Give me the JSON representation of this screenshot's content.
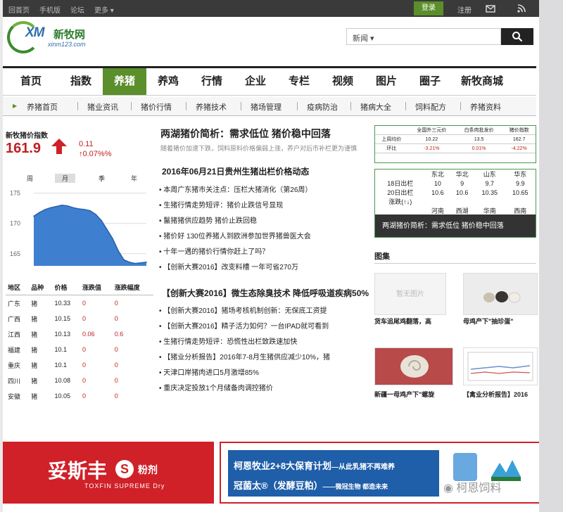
{
  "topbar": {
    "links": [
      "回首页",
      "手机版",
      "论坛",
      "更多 ▾"
    ],
    "login": "登录",
    "register": "注册"
  },
  "logo": {
    "main": "XM",
    "name": "新牧网",
    "url": "xinm123.com"
  },
  "search": {
    "category": "新闻 ▾",
    "button_icon": "search-icon"
  },
  "nav": [
    "首页",
    "指数",
    "养猪",
    "养鸡",
    "行情",
    "企业",
    "专栏",
    "视频",
    "图片",
    "圈子",
    "新牧商城"
  ],
  "nav_active": "养猪",
  "subnav": [
    "养猪首页",
    "猪业资讯",
    "猪价行情",
    "养猪技术",
    "猪场管理",
    "疫病防治",
    "猪病大全",
    "饲料配方",
    "养猪资料"
  ],
  "index": {
    "title": "新牧猪价指数",
    "value": "161.9",
    "change": "0.11",
    "change_pct": "↑0.07%%",
    "tabs": [
      "周",
      "月",
      "季",
      "年"
    ],
    "active_tab": "月"
  },
  "chart_data": {
    "type": "area",
    "yticks": [
      "175",
      "170",
      "165"
    ],
    "ylim": [
      163,
      176
    ],
    "values": [
      171.2,
      171.8,
      172.3,
      172.6,
      172.8,
      173.0,
      172.9,
      172.6,
      172.4,
      172.3,
      172.1,
      171.5,
      170.5,
      169.0,
      167.5,
      165.5,
      164.0,
      163.6,
      163.4,
      163.5,
      163.6
    ]
  },
  "price_table": {
    "headers": [
      "地区",
      "品种",
      "价格",
      "涨跌值",
      "涨跌幅度"
    ],
    "rows": [
      [
        "广东",
        "猪",
        "10.33",
        "0",
        "0"
      ],
      [
        "广西",
        "猪",
        "10.15",
        "0",
        "0"
      ],
      [
        "江西",
        "猪",
        "10.13",
        "0.06",
        "0.6"
      ],
      [
        "福建",
        "猪",
        "10.1",
        "0",
        "0"
      ],
      [
        "重庆",
        "猪",
        "10.1",
        "0",
        "0"
      ],
      [
        "四川",
        "猪",
        "10.08",
        "0",
        "0"
      ],
      [
        "安徽",
        "猪",
        "10.05",
        "0",
        "0"
      ]
    ]
  },
  "main": {
    "headline": "两湖猪价简析：需求低位 猪价稳中回落",
    "desc": "随着猪价加速下跌，饲料原料价格偏弱上涨，养户对后市补栏更为谨慎",
    "section1": "2016年06月21日贵州生猪出栏价格动态",
    "list1": [
      "本周广东猪市关注点：压栏大猪消化（第26周）",
      "生猪行情走势短评：猪价止跌信号显现",
      "鬣猪猪供应趋势 猪价止跌回稳",
      "猪价好 130位养猪人到欧洲参加世界猪兽医大会",
      "十年一遇的猪价行情你赶上了吗？",
      "【创新大赛2016】改变料槽 一年可省270万"
    ],
    "section2": "【创新大赛2016】微生态除臭技术 降低呼吸道疾病50%",
    "list2": [
      "【创新大赛2016】猪场考核机制创新：无保底工资提",
      "【创新大赛2016】精子活力如何？一台IPAD就可看到",
      "生猪行情走势短评：恐慌性出栏致跌速加快",
      "【猪业分析报告】2016年7-8月生猪供应减少10%，猪",
      "天津口岸猪肉进口5月激增85%",
      "重庆决定投放1个月储备肉调控猪价"
    ]
  },
  "right": {
    "t1": {
      "head": [
        "",
        "全国外三元价",
        "白条肉批发价",
        "猪价指数"
      ],
      "rows": [
        [
          "上周均价",
          "10.22",
          "13.5",
          "162.7"
        ],
        [
          "环比",
          "-3.21%",
          "0.01%",
          "-4.22%"
        ]
      ]
    },
    "t2": {
      "head": [
        "",
        "东北",
        "华北",
        "山东",
        "华东"
      ],
      "rows": [
        [
          "18日出栏",
          "10",
          "9",
          "9.7",
          "9.9"
        ],
        [
          "20日出栏",
          "10.6",
          "10.6",
          "10.35",
          "10.65"
        ],
        [
          "涨跌(↑↓)",
          "",
          "",
          "",
          ""
        ],
        [
          "",
          "河南",
          "西湖",
          "华南",
          "西南"
        ],
        [
          "18日出栏",
          "9.4",
          "9.7",
          "10.3",
          "10.1"
        ]
      ]
    },
    "caption": "两湖猪价简析：需求低位 猪价稳中回落",
    "gallery_title": "图集",
    "no_image": "暂无图片",
    "photos": [
      "货车追尾鸡翻落，高",
      "母鸡产下\"抽珍蛋\"",
      "新疆一母鸡产下\"螺旋",
      "【禽业分析报告】2016"
    ]
  },
  "banners": {
    "b1_title": "妥斯丰",
    "b1_suffix": "粉剂",
    "b1_sub": "TOXFIN SUPREME Dry",
    "b2_line1": "柯恩牧业2+8大保育计划",
    "b2_line1b": "—从此乳猪不再难养",
    "b2_line2": "冠菌太®（发酵豆粕）",
    "b2_line2b": "——微冠生物  都造未来",
    "watermark": "柯恩饲料"
  },
  "colors": {
    "green": "#5a8f2b",
    "red": "#d02028",
    "dark": "#3a3a3a",
    "blue": "#1f5ea8"
  }
}
